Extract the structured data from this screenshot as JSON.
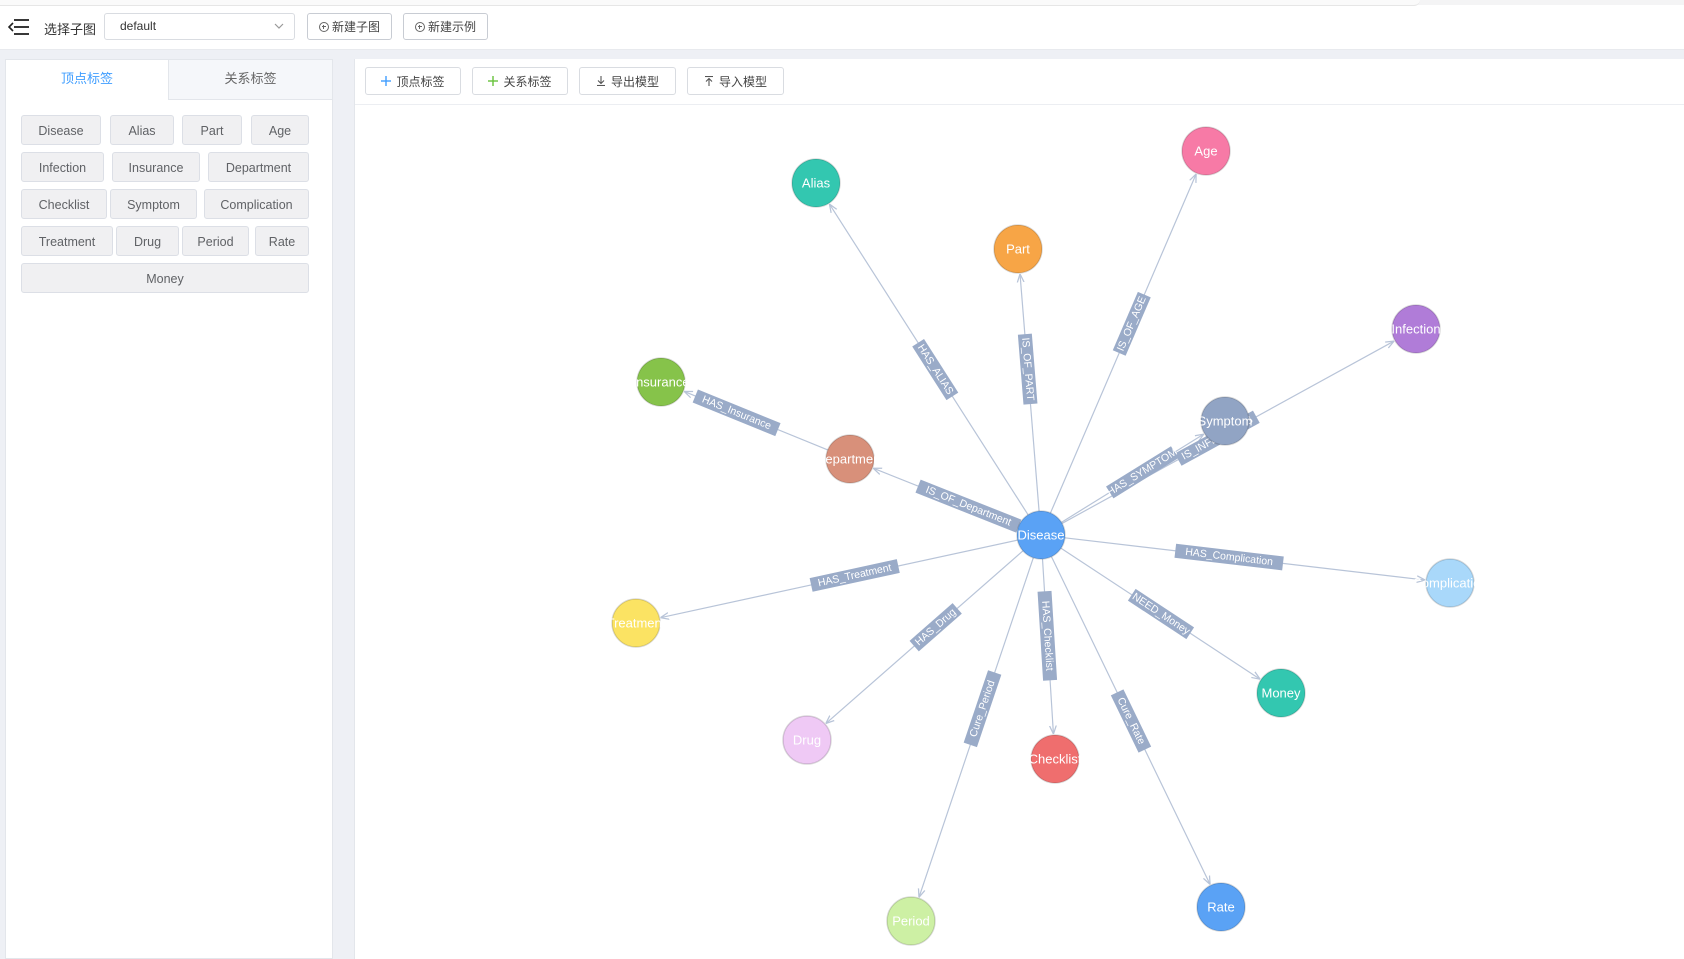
{
  "toolbar": {
    "select_subgraph_label": "选择子图",
    "subgraph_value": "default",
    "new_subgraph_label": "新建子图",
    "new_example_label": "新建示例"
  },
  "left_panel": {
    "tabs": [
      {
        "label": "顶点标签",
        "active": true
      },
      {
        "label": "关系标签",
        "active": false
      }
    ],
    "vertex_tags": [
      "Disease",
      "Alias",
      "Part",
      "Age",
      "Infection",
      "Insurance",
      "Department",
      "Checklist",
      "Symptom",
      "Complication",
      "Treatment",
      "Drug",
      "Period",
      "Rate",
      "Money"
    ]
  },
  "canvas_toolbar": {
    "add_vertex_label": "顶点标签",
    "add_edge_label": "关系标签",
    "export_label": "导出模型",
    "import_label": "导入模型"
  },
  "graph": {
    "center": "Disease",
    "nodes": [
      {
        "id": "Disease",
        "label": "Disease",
        "color": "#5aa2f5"
      },
      {
        "id": "Alias",
        "label": "Alias",
        "color": "#33c7b0"
      },
      {
        "id": "Part",
        "label": "Part",
        "color": "#f7a546"
      },
      {
        "id": "Age",
        "label": "Age",
        "color": "#f77aa6"
      },
      {
        "id": "Infection",
        "label": "Infection",
        "color": "#b07cd8"
      },
      {
        "id": "Symptom",
        "label": "Symptom",
        "color": "#91a4c4"
      },
      {
        "id": "Insurance",
        "label": "Insurance",
        "color": "#86c34a"
      },
      {
        "id": "Department",
        "label": "Department",
        "color": "#d8907a"
      },
      {
        "id": "Complication",
        "label": "Complication",
        "color": "#a9d8fa"
      },
      {
        "id": "Treatment",
        "label": "Treatment",
        "color": "#fbe363"
      },
      {
        "id": "Drug",
        "label": "Drug",
        "color": "#efc9f5"
      },
      {
        "id": "Money",
        "label": "Money",
        "color": "#33c7b0"
      },
      {
        "id": "Checklist",
        "label": "Checklist",
        "color": "#ef6e6e"
      },
      {
        "id": "Period",
        "label": "Period",
        "color": "#cdf0a4"
      },
      {
        "id": "Rate",
        "label": "Rate",
        "color": "#5aa2f5"
      }
    ],
    "edges": [
      {
        "label": "HAS_ALIAS",
        "target": "Alias"
      },
      {
        "label": "IS_OF_PART",
        "target": "Part"
      },
      {
        "label": "IS_OF_AGE",
        "target": "Age"
      },
      {
        "label": "IS_INFECTIOUS",
        "target": "Infection"
      },
      {
        "label": "HAS_SYMPTOM",
        "target": "Symptom"
      },
      {
        "label": "IS_OF_Department",
        "target": "Department"
      },
      {
        "label": "HAS_Insurance",
        "target": "Insurance"
      },
      {
        "label": "HAS_Complication",
        "target": "Complication"
      },
      {
        "label": "HAS_Treatment",
        "target": "Treatment"
      },
      {
        "label": "HAS_Drug",
        "target": "Drug"
      },
      {
        "label": "NEED_Money",
        "target": "Money"
      },
      {
        "label": "HAS_Checklist",
        "target": "Checklist"
      },
      {
        "label": "Cure_Period",
        "target": "Period"
      },
      {
        "label": "Cure_Rate",
        "target": "Rate"
      }
    ],
    "edge_label_color": "#9aabc8",
    "edge_color": "#b8c4d8"
  }
}
